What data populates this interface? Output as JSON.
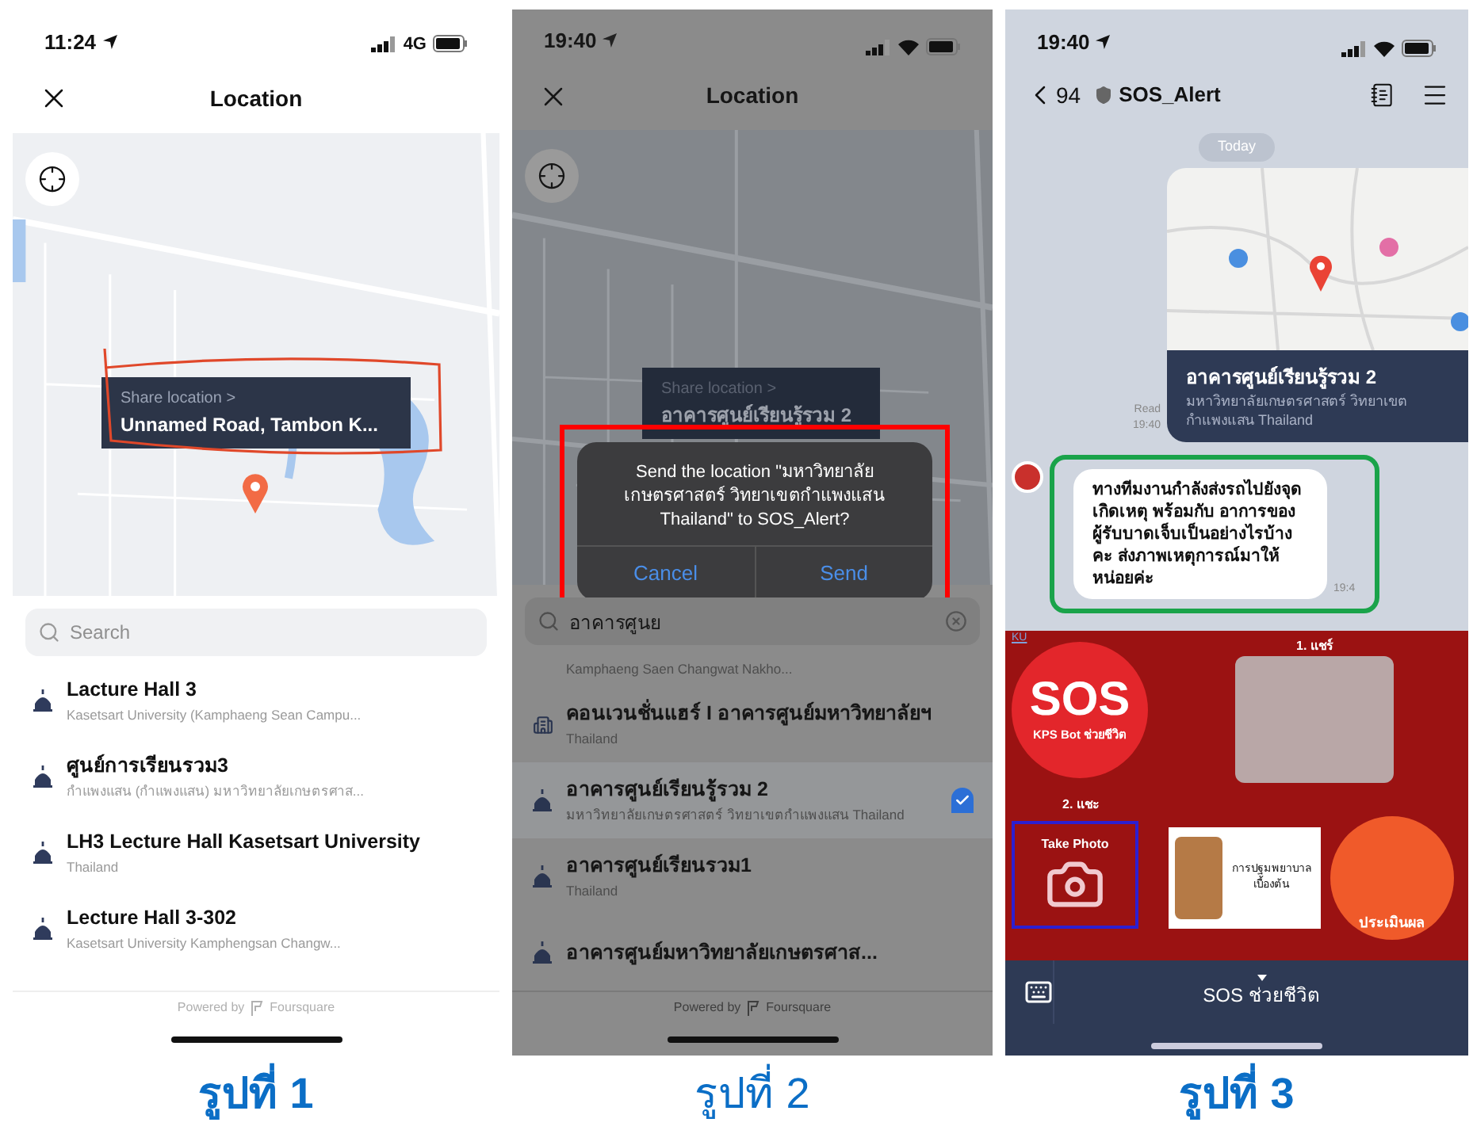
{
  "screens": [
    {
      "kind": "picker",
      "dimmed": false,
      "status_time": "11:24",
      "network": "4G",
      "title": "Location",
      "callout": {
        "hint": "Share location >",
        "address": "Unnamed Road, Tambon K..."
      },
      "search": {
        "placeholder": "Search"
      },
      "places": [
        {
          "kind": "landmark",
          "name": "Lacture Hall 3",
          "detail": "Kasetsart University (Kamphaeng Sean Campu...",
          "selected": false
        },
        {
          "kind": "landmark",
          "name": "ศูนย์การเรียนรวม3",
          "detail": "กำแพงแสน (กำแพงแสน) มหาวิทยาลัยเกษตรศาส...",
          "selected": false
        },
        {
          "kind": "landmark",
          "name": "LH3 Lecture Hall Kasetsart University",
          "detail": "Thailand",
          "selected": false
        },
        {
          "kind": "landmark",
          "name": "Lecture Hall 3-302",
          "detail": "Kasetsart University Kamphengsan Changw...",
          "selected": false
        }
      ],
      "footer": "Powered by",
      "brand": "Foursquare"
    },
    {
      "kind": "picker",
      "dimmed": true,
      "status_time": "19:40",
      "title": "Location",
      "callout": {
        "hint": "Share location >",
        "address": "อาคารศูนย์เรียนรู้รวม 2"
      },
      "dialog": {
        "message": "Send the location \"มหาวิทยาลัยเกษตรศาสตร์ วิทยาเขตกำแพงแสน Thailand\" to SOS_Alert?",
        "buttons": [
          "Cancel",
          "Send"
        ]
      },
      "search": {
        "value": "อาคารศูนย"
      },
      "places": [
        {
          "detail": "Kamphaeng Saen Changwat Nakho...",
          "selected": false
        },
        {
          "kind": "building",
          "name": "คอนเวนชั่นแฮร์ I อาคารศูนย์มหาวิทยาลัยฯ",
          "detail": "Thailand",
          "selected": false
        },
        {
          "kind": "landmark",
          "name": "อาคารศูนย์เรียนรู้รวม 2",
          "detail": "มหาวิทยาลัยเกษตรศาสตร์ วิทยาเขตกำแพงแสน Thailand",
          "selected": true
        },
        {
          "kind": "landmark",
          "name": "อาคารศูนย์เรียนรวม1",
          "detail": "Thailand",
          "selected": false
        },
        {
          "kind": "landmark",
          "name": "อาคารศูนย์มหาวิทยาลัยเกษตรศาส...",
          "selected": false
        }
      ],
      "footer": "Powered by",
      "brand": "Foursquare"
    },
    {
      "kind": "chat",
      "status_time": "19:40",
      "back_count": "94",
      "title": "SOS_Alert",
      "date": "Today",
      "location_card": {
        "title": "อาคารศูนย์เรียนรู้รวม 2",
        "address": "มหาวิทยาลัยเกษตรศาสตร์ วิทยาเขตกำแพงแสน Thailand",
        "read": "Read",
        "time": "19:40"
      },
      "message": {
        "text": "ทางทีมงานกำลังส่งรถไปยังจุดเกิดเหตุ พร้อมกับ อาการของผู้รับบาดเจ็บเป็นอย่างไรบ้างคะ ส่งภาพเหตุการณ์มาให้หน่อยค่ะ",
        "time": "19:4"
      },
      "rich_menu": {
        "logo": "KU",
        "sos": "SOS",
        "sos_caption": "KPS Bot ช่วยชีวิต",
        "step_1": "1. แชร์",
        "step_2": "2. แชะ",
        "photo": "Take Photo",
        "first_aid": "การปฐมพยาบาลเบื้องต้น",
        "evaluate": "ประเมินผล"
      },
      "menu_label": "SOS ช่วยชีวิต"
    }
  ],
  "captions": [
    {
      "text": "รูปที่ 1",
      "bold": true
    },
    {
      "text": "รูปที่ 2",
      "bold": false
    },
    {
      "text": "รูปที่ 3",
      "bold": true
    }
  ]
}
